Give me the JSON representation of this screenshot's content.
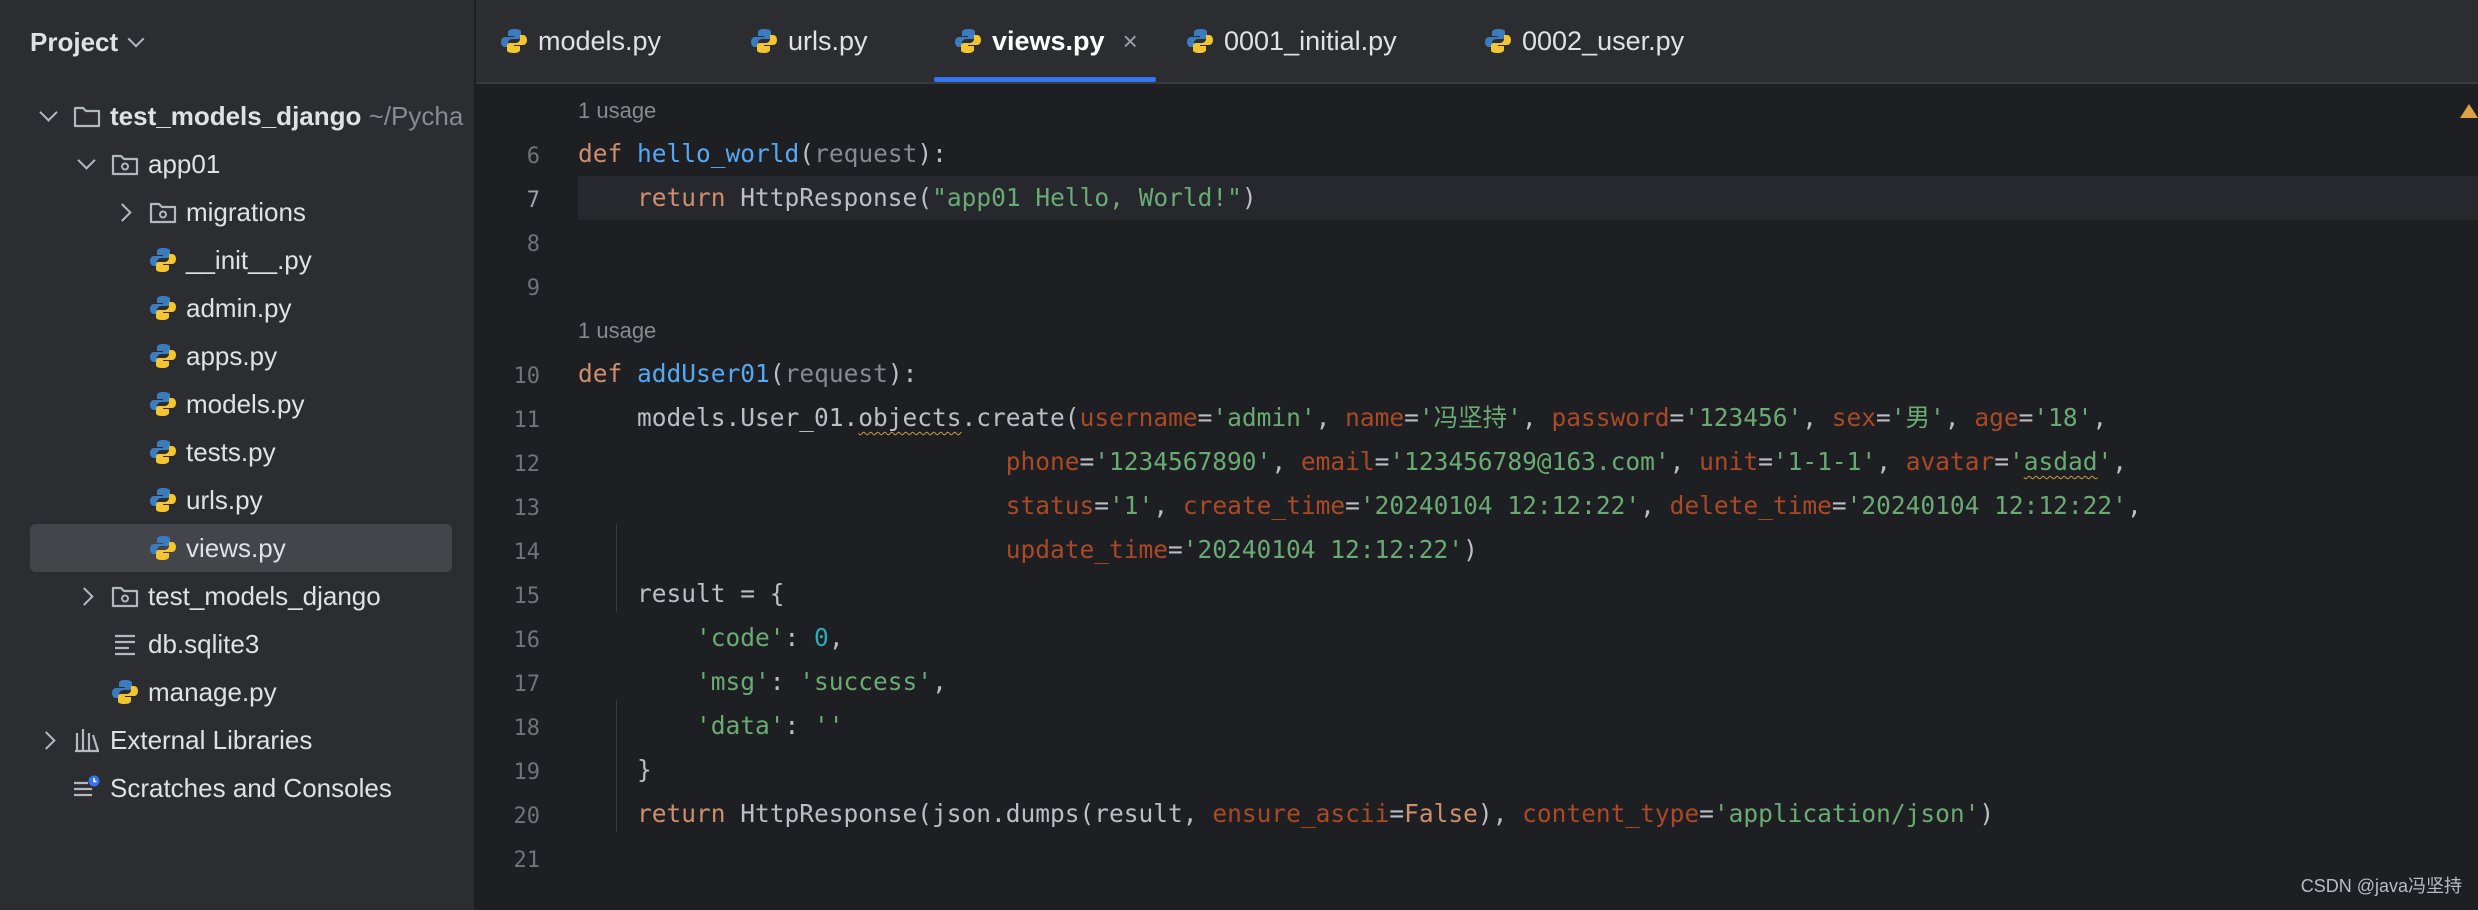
{
  "sidebar": {
    "title": "Project",
    "tree": {
      "root": {
        "name": "test_models_django",
        "path": "~/Pycha"
      },
      "app01": "app01",
      "migrations": "migrations",
      "init": "__init__.py",
      "admin": "admin.py",
      "apps": "apps.py",
      "models": "models.py",
      "tests": "tests.py",
      "urls": "urls.py",
      "views": "views.py",
      "pkg": "test_models_django",
      "db": "db.sqlite3",
      "manage": "manage.py",
      "external": "External Libraries",
      "scratches": "Scratches and Consoles"
    }
  },
  "tabs": [
    {
      "label": "models.py"
    },
    {
      "label": "urls.py"
    },
    {
      "label": "views.py",
      "active": true,
      "close": "×"
    },
    {
      "label": "0001_initial.py"
    },
    {
      "label": "0002_user.py"
    }
  ],
  "editor": {
    "usage_label": "1 usage",
    "line_numbers": [
      "6",
      "7",
      "8",
      "9",
      "10",
      "11",
      "12",
      "13",
      "14",
      "15",
      "16",
      "17",
      "18",
      "19",
      "20",
      "21"
    ],
    "current_line": "7",
    "code": {
      "l6": {
        "kw": "def",
        "name": "hello_world",
        "param": "request"
      },
      "l7": {
        "kw": "return",
        "call": "HttpResponse",
        "str": "\"app01 Hello, World!\""
      },
      "l10": {
        "kw": "def",
        "name": "addUser01",
        "param": "request"
      },
      "l11": {
        "obj": "models.User_01.",
        "attr": "objects",
        "rest": ".create(",
        "a1k": "username",
        "a1v": "'admin'",
        "a2k": "name",
        "a2v": "'冯坚持'",
        "a3k": "password",
        "a3v": "'123456'",
        "a4k": "sex",
        "a4v": "'男'",
        "a5k": "age",
        "a5v": "'18'"
      },
      "l12": {
        "a1k": "phone",
        "a1v": "'1234567890'",
        "a2k": "email",
        "a2v": "'123456789@163.com'",
        "a3k": "unit",
        "a3v": "'1-1-1'",
        "a4k": "avatar",
        "a4q": "'",
        "a4v": "asdad",
        "a4e": "'"
      },
      "l13": {
        "a1k": "status",
        "a1v": "'1'",
        "a2k": "create_time",
        "a2v": "'20240104 12:12:22'",
        "a3k": "delete_time",
        "a3v": "'20240104 12:12:22'"
      },
      "l14": {
        "a1k": "update_time",
        "a1v": "'20240104 12:12:22'"
      },
      "l15": {
        "text": "result = {"
      },
      "l16": {
        "key": "'code'",
        "num": "0"
      },
      "l17": {
        "key": "'msg'",
        "val": "'success'"
      },
      "l18": {
        "key": "'data'",
        "val": "''"
      },
      "l19": {
        "text": "}"
      },
      "l20": {
        "kw": "return",
        "call": "HttpResponse(json.dumps(result, ",
        "k1": "ensure_ascii",
        "v1": "False",
        "k2": "content_type",
        "v2": "'application/json'"
      }
    }
  },
  "watermark": "CSDN @java冯坚持",
  "colors": {
    "accent": "#3574f0",
    "keyword": "#cf8e6d",
    "function": "#56a8f5",
    "string": "#6aab73",
    "param": "#aa4926"
  }
}
